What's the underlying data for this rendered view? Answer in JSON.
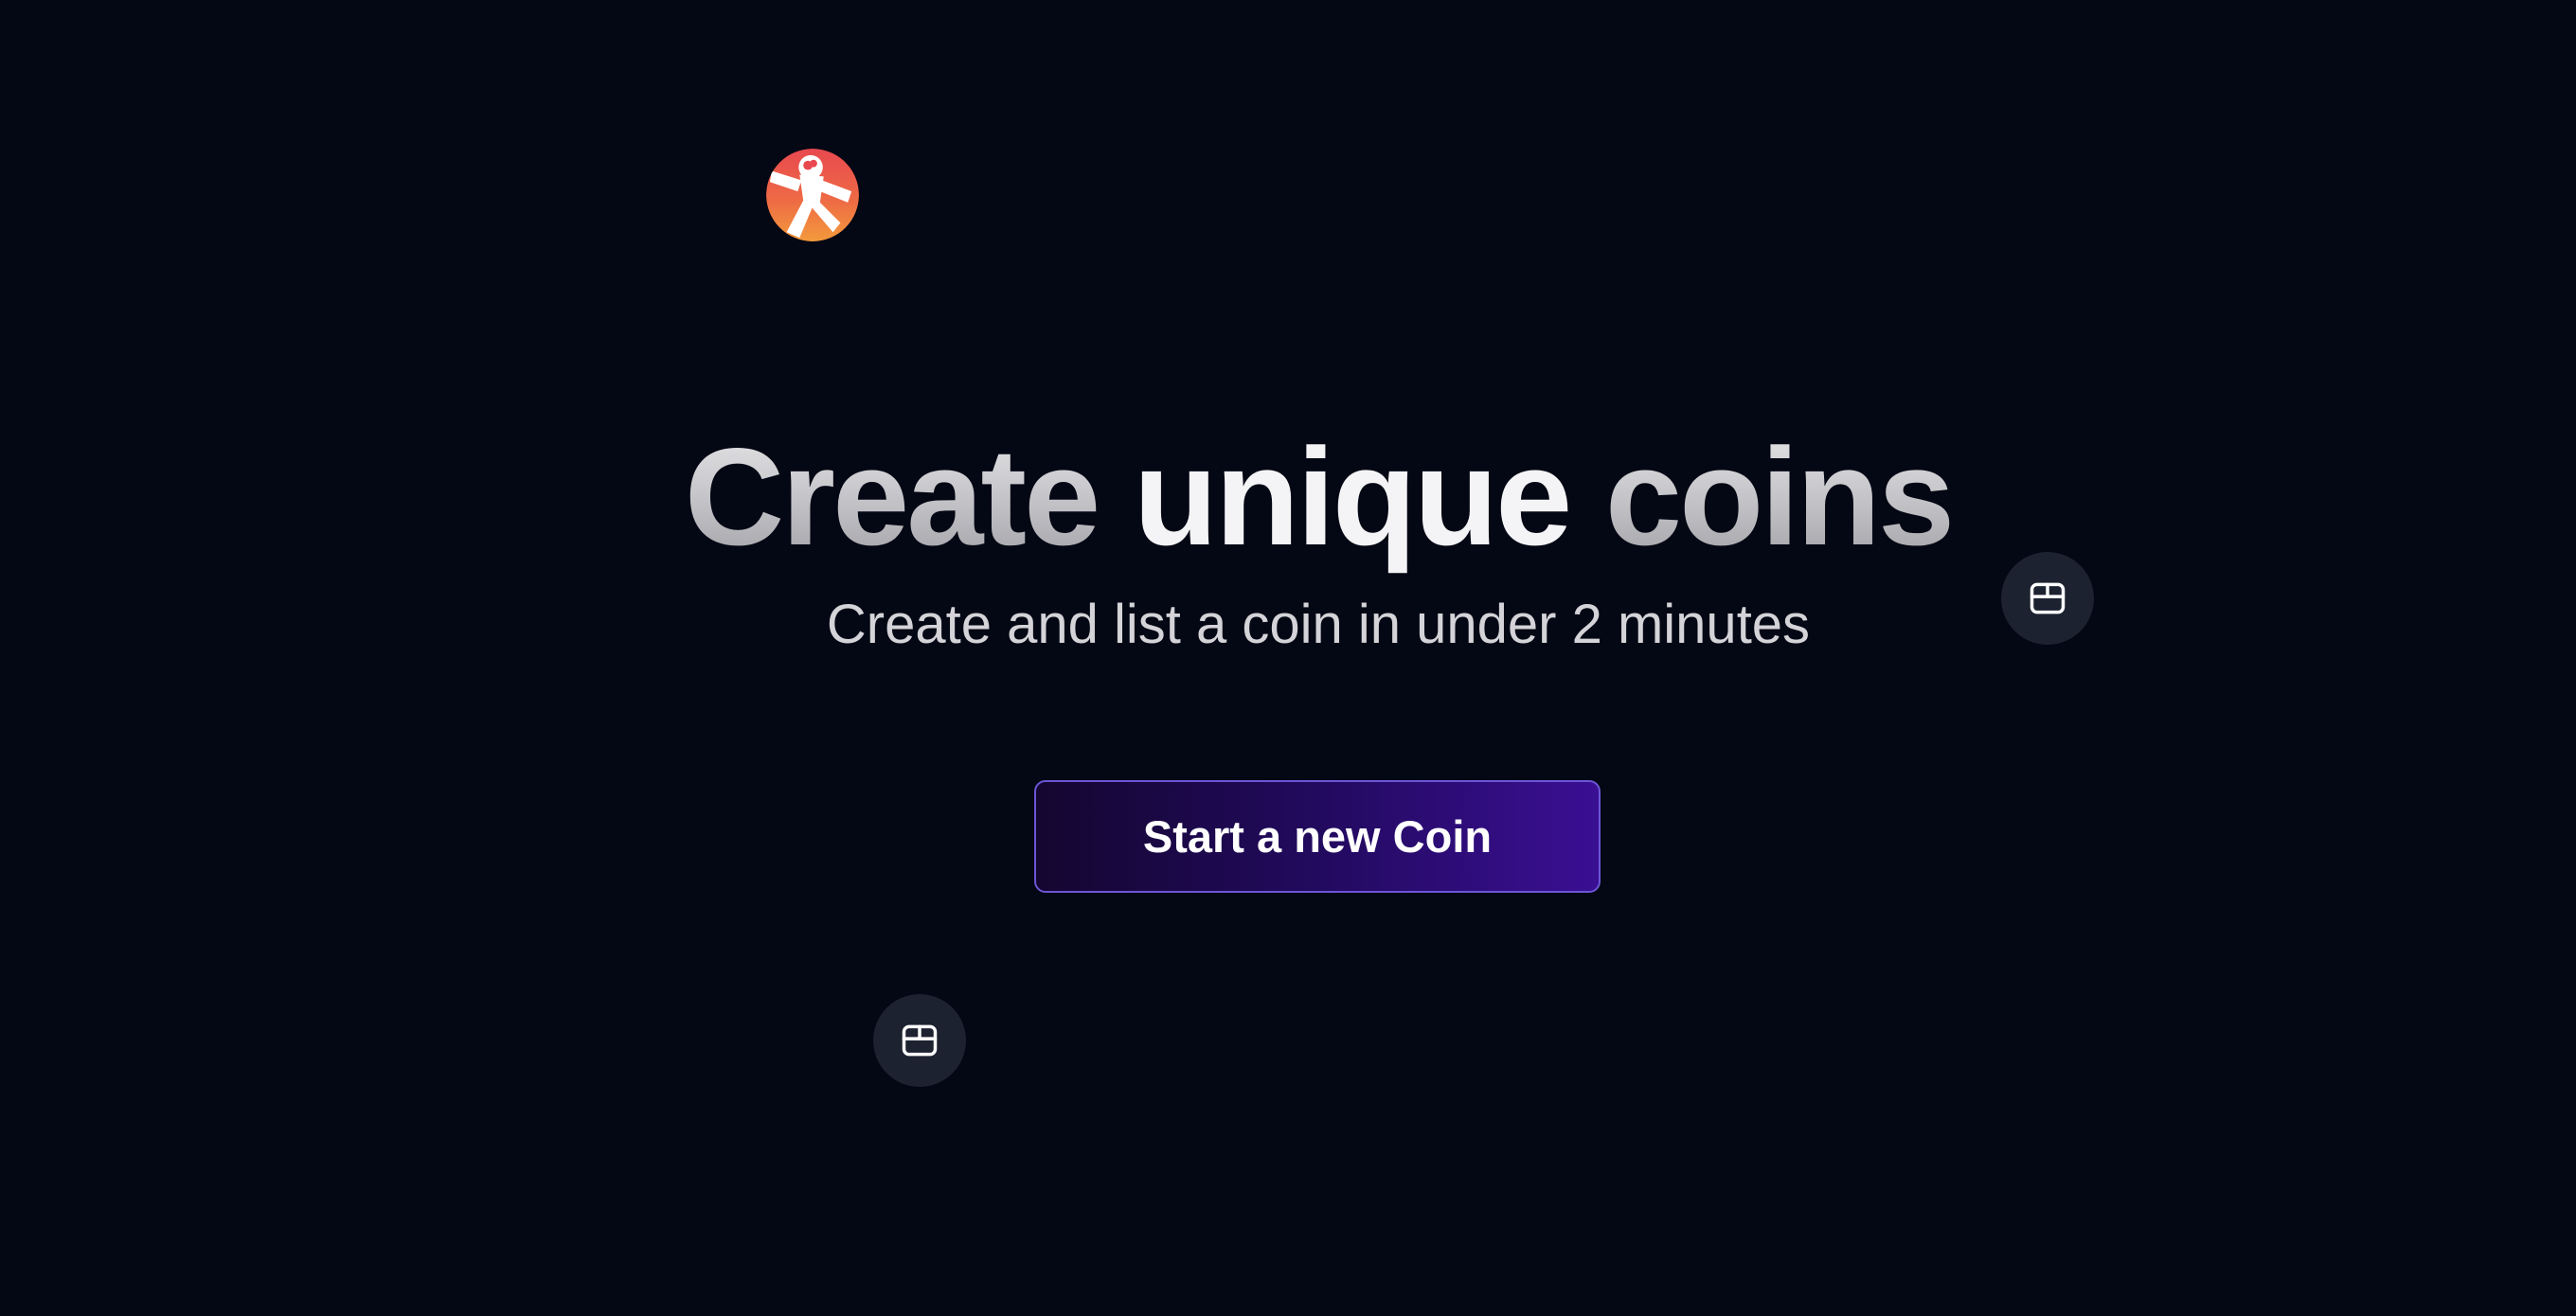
{
  "hero": {
    "headline": {
      "part1": "Create ",
      "part2": "unique",
      "part3": " coins"
    },
    "subtitle": "Create and list a coin in under 2 minutes",
    "cta_label": "Start a new Coin"
  },
  "decor": {
    "avatar_icon": "astronaut-avatar-icon",
    "floating_icon": "box-icon"
  },
  "colors": {
    "background": "#040714",
    "cta_gradient_start": "#140630",
    "cta_gradient_end": "#3a0f93",
    "cta_border": "#6b56d6",
    "icon_bubble": "#1c2230"
  }
}
